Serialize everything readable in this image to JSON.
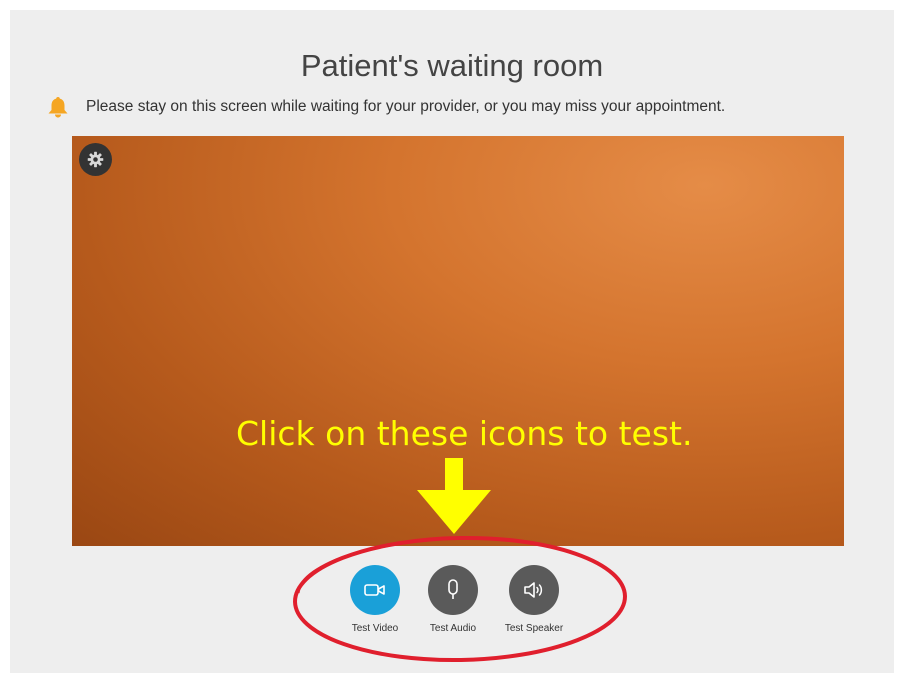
{
  "page": {
    "title": "Patient's waiting room",
    "notice": "Please stay on this screen while waiting for your provider, or you may miss your appointment."
  },
  "video": {
    "settings_icon": "gear-icon"
  },
  "annotation": {
    "callout": "Click on these icons to test.",
    "arrow_icon": "arrow-down-icon",
    "highlight_color": "#e01f2d",
    "callout_color": "#ffff00"
  },
  "controls": [
    {
      "label": "Test Video",
      "icon": "video-camera-icon",
      "active": true,
      "color": "#1aa0d8"
    },
    {
      "label": "Test Audio",
      "icon": "microphone-icon",
      "active": false,
      "color": "#5a5a5a"
    },
    {
      "label": "Test Speaker",
      "icon": "speaker-icon",
      "active": false,
      "color": "#5a5a5a"
    }
  ],
  "colors": {
    "background": "#eeeeee",
    "warning": "#f5a623"
  }
}
